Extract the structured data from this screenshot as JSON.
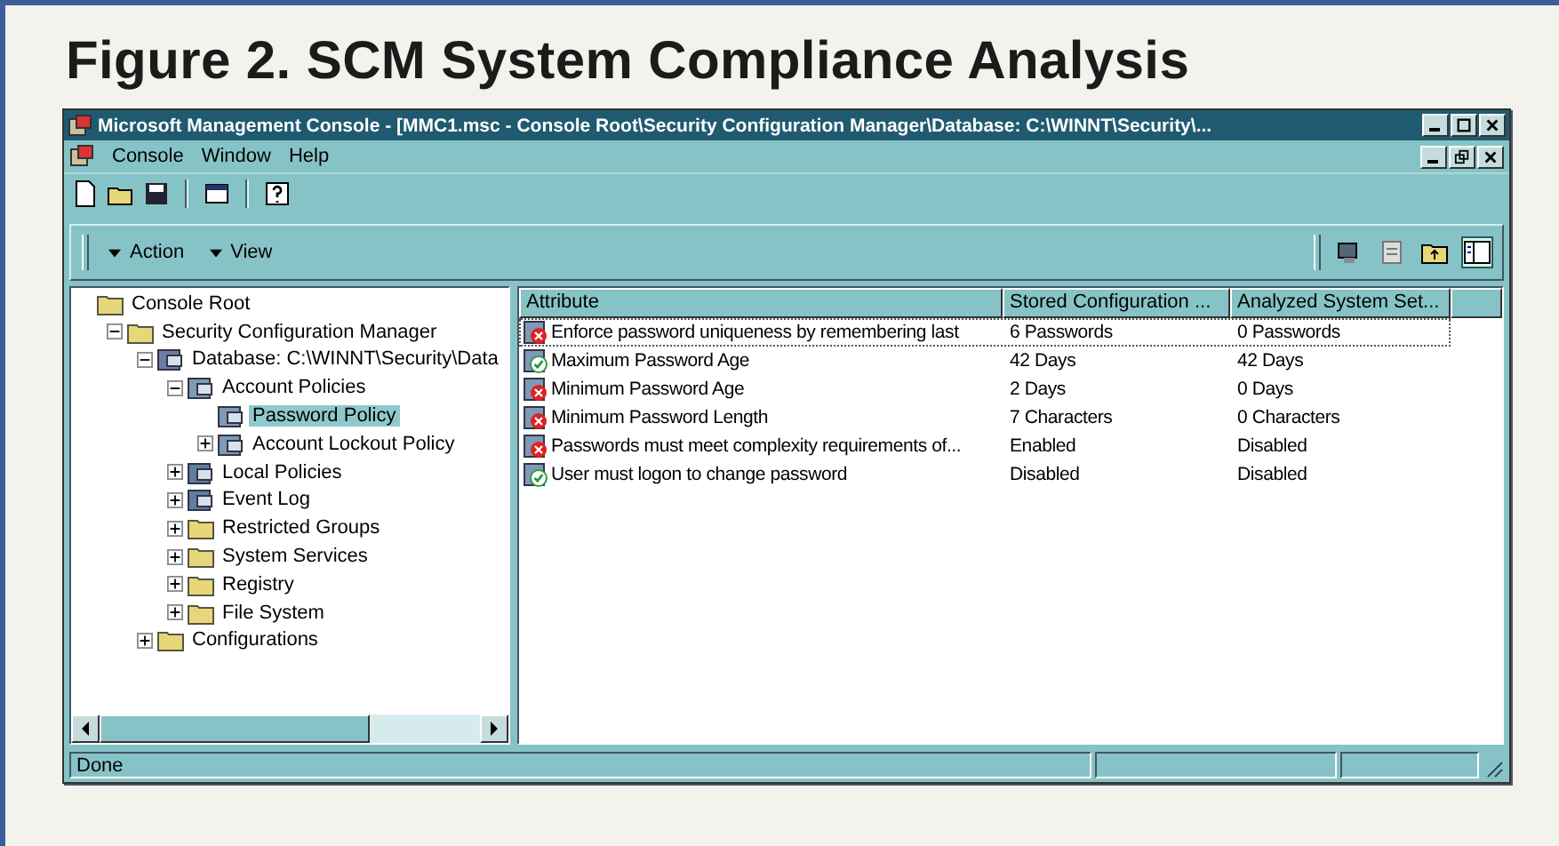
{
  "figure_title": "Figure 2. SCM System Compliance Analysis",
  "window": {
    "title": "Microsoft Management Console - [MMC1.msc - Console Root\\Security Configuration Manager\\Database: C:\\WINNT\\Security\\..."
  },
  "menu": [
    "Console",
    "Window",
    "Help"
  ],
  "action_bar": [
    "Action",
    "View"
  ],
  "tree": [
    {
      "label": "Console Root",
      "kind": "folder",
      "selected": false,
      "children": [
        {
          "label": "Security Configuration Manager",
          "kind": "folder",
          "expanded": true,
          "selected": false,
          "children": [
            {
              "label": "Database: C:\\WINNT\\Security\\Data",
              "kind": "database",
              "expanded": true,
              "selected": false,
              "children": [
                {
                  "label": "Account Policies",
                  "kind": "policy",
                  "expanded": true,
                  "selected": false,
                  "children": [
                    {
                      "label": "Password Policy",
                      "kind": "policy",
                      "selected": true
                    },
                    {
                      "label": "Account Lockout Policy",
                      "kind": "policy",
                      "expanded": false,
                      "selected": false
                    }
                  ]
                },
                {
                  "label": "Local Policies",
                  "kind": "log",
                  "expanded": false,
                  "selected": false
                },
                {
                  "label": "Event Log",
                  "kind": "log",
                  "expanded": false,
                  "selected": false
                },
                {
                  "label": "Restricted Groups",
                  "kind": "folder",
                  "expanded": false,
                  "selected": false
                },
                {
                  "label": "System Services",
                  "kind": "folder",
                  "expanded": false,
                  "selected": false
                },
                {
                  "label": "Registry",
                  "kind": "folder",
                  "expanded": false,
                  "selected": false
                },
                {
                  "label": "File System",
                  "kind": "folder",
                  "expanded": false,
                  "selected": false
                }
              ]
            },
            {
              "label": "Configurations",
              "kind": "folder",
              "expanded": false,
              "selected": false
            }
          ]
        }
      ]
    }
  ],
  "table": {
    "columns": [
      "Attribute",
      "Stored Configuration ...",
      "Analyzed System Set..."
    ],
    "rows": [
      {
        "kind": "mismatch",
        "selected": true,
        "cells": [
          "Enforce password uniqueness by remembering last",
          "6 Passwords",
          "0 Passwords"
        ]
      },
      {
        "kind": "match",
        "selected": false,
        "cells": [
          "Maximum Password Age",
          "42 Days",
          "42 Days"
        ]
      },
      {
        "kind": "mismatch",
        "selected": false,
        "cells": [
          "Minimum Password Age",
          "2 Days",
          "0 Days"
        ]
      },
      {
        "kind": "mismatch",
        "selected": false,
        "cells": [
          "Minimum Password Length",
          "7 Characters",
          "0 Characters"
        ]
      },
      {
        "kind": "mismatch",
        "selected": false,
        "cells": [
          "Passwords must meet complexity requirements of...",
          "Enabled",
          "Disabled"
        ]
      },
      {
        "kind": "match",
        "selected": false,
        "cells": [
          "User must logon to change password",
          "Disabled",
          "Disabled"
        ]
      }
    ]
  },
  "status_bar": "Done"
}
